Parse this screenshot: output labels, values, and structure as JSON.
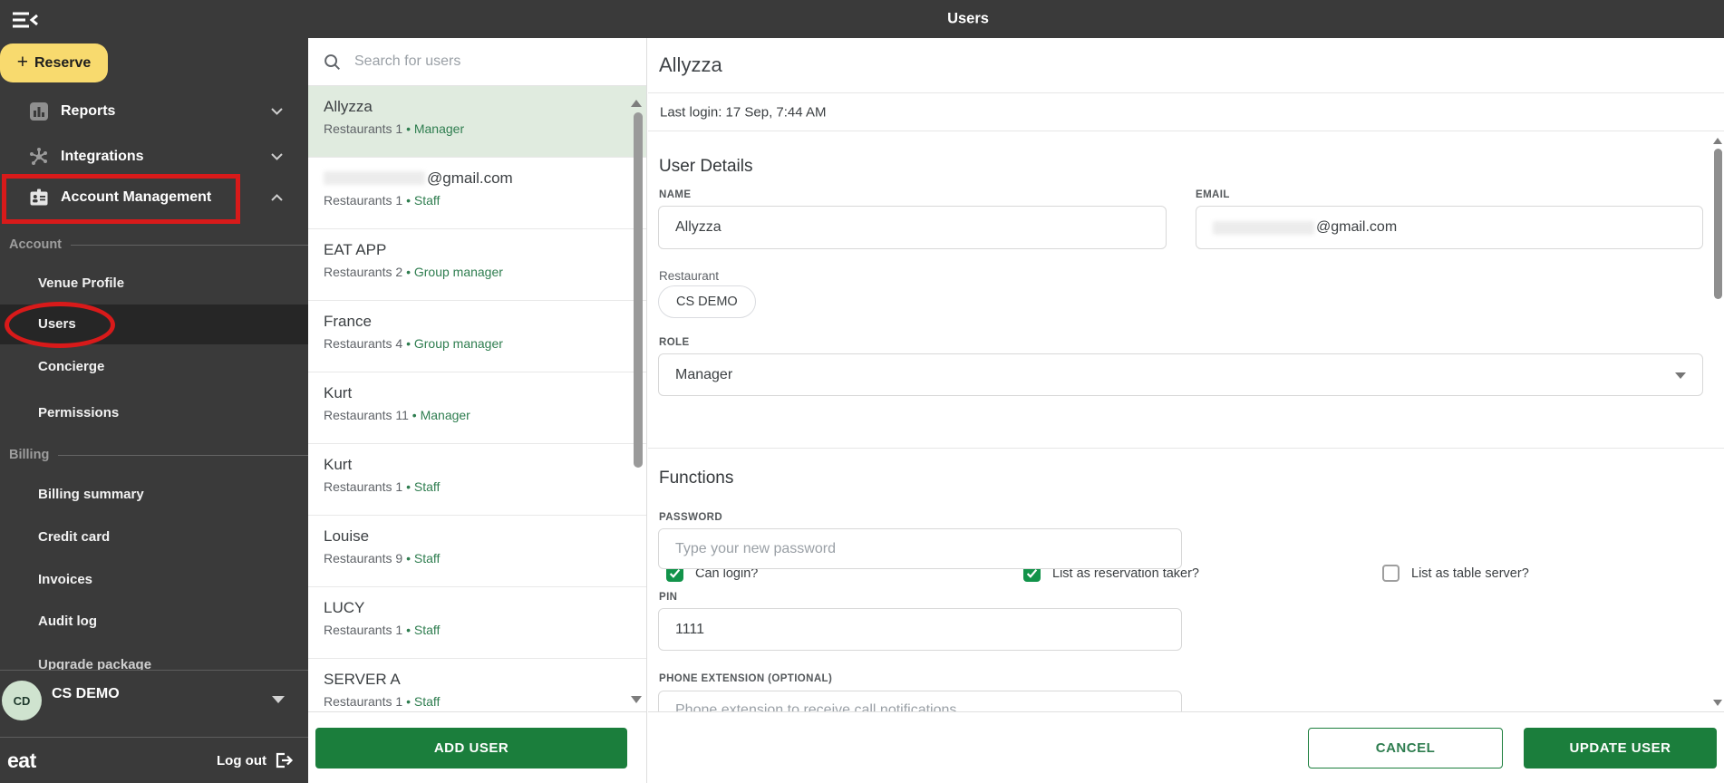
{
  "colors": {
    "chrome_dark": "#3a3a3a",
    "selected_nav": "#262626",
    "reserve_yellow": "#f8da6e",
    "button_green": "#1b7e3c",
    "checkbox_green": "#12934a",
    "role_text_green": "#2e7d4f",
    "selected_row_bg": "#e0ebdf",
    "annotation_red": "#d81a1a",
    "avatar_bg": "#cfe3cf"
  },
  "icons": {
    "plus": "+",
    "bullet": "•"
  },
  "topbar": {
    "title": "Users"
  },
  "sidebar": {
    "reserve_label": "Reserve",
    "nav": [
      {
        "label": "Reports"
      },
      {
        "label": "Integrations"
      },
      {
        "label": "Account Management"
      }
    ],
    "sections": [
      {
        "label": "Account",
        "items": [
          {
            "label": "Venue Profile"
          },
          {
            "label": "Users",
            "selected": true,
            "annotated": true
          },
          {
            "label": "Concierge"
          },
          {
            "label": "Permissions"
          }
        ]
      },
      {
        "label": "Billing",
        "items": [
          {
            "label": "Billing summary"
          },
          {
            "label": "Credit card"
          },
          {
            "label": "Invoices"
          },
          {
            "label": "Audit log"
          },
          {
            "label": "Upgrade package",
            "clipped": true
          }
        ]
      }
    ],
    "workspace": {
      "initials": "CD",
      "name": "CS DEMO"
    },
    "logo": "eat",
    "logout_label": "Log out"
  },
  "user_list": {
    "search_placeholder": "Search for users",
    "items": [
      {
        "name": "Allyzza",
        "restaurants": "Restaurants 1",
        "role": "Manager",
        "selected": true
      },
      {
        "name": "@gmail.com",
        "restaurants": "Restaurants 1",
        "role": "Staff",
        "redacted": true
      },
      {
        "name": "EAT APP",
        "restaurants": "Restaurants 2",
        "role": "Group manager"
      },
      {
        "name": "France",
        "restaurants": "Restaurants 4",
        "role": "Group manager"
      },
      {
        "name": "Kurt",
        "restaurants": "Restaurants 11",
        "role": "Manager"
      },
      {
        "name": "Kurt",
        "restaurants": "Restaurants 1",
        "role": "Staff"
      },
      {
        "name": "Louise",
        "restaurants": "Restaurants 9",
        "role": "Staff"
      },
      {
        "name": "LUCY",
        "restaurants": "Restaurants 1",
        "role": "Staff"
      },
      {
        "name": "SERVER A",
        "restaurants": "Restaurants 1",
        "role": "Staff"
      }
    ],
    "add_user_label": "ADD USER"
  },
  "detail": {
    "title": "Allyzza",
    "last_login": "Last login: 17 Sep, 7:44 AM",
    "user_details_heading": "User Details",
    "name_label": "NAME",
    "name_value": "Allyzza",
    "email_label": "EMAIL",
    "email_value": "@gmail.com",
    "restaurant_label": "Restaurant",
    "restaurant_chip": "CS DEMO",
    "role_label": "ROLE",
    "role_value": "Manager",
    "functions_heading": "Functions",
    "checkboxes": [
      {
        "label": "Can login?",
        "checked": true
      },
      {
        "label": "List as reservation taker?",
        "checked": true
      },
      {
        "label": "List as table server?",
        "checked": false
      }
    ],
    "password_label": "PASSWORD",
    "password_placeholder": "Type your new password",
    "pin_label": "PIN",
    "pin_value": "1111",
    "phone_label": "PHONE EXTENSION (OPTIONAL)",
    "phone_placeholder": "Phone extension to receive call notifications",
    "cancel_label": "CANCEL",
    "update_label": "UPDATE USER"
  }
}
